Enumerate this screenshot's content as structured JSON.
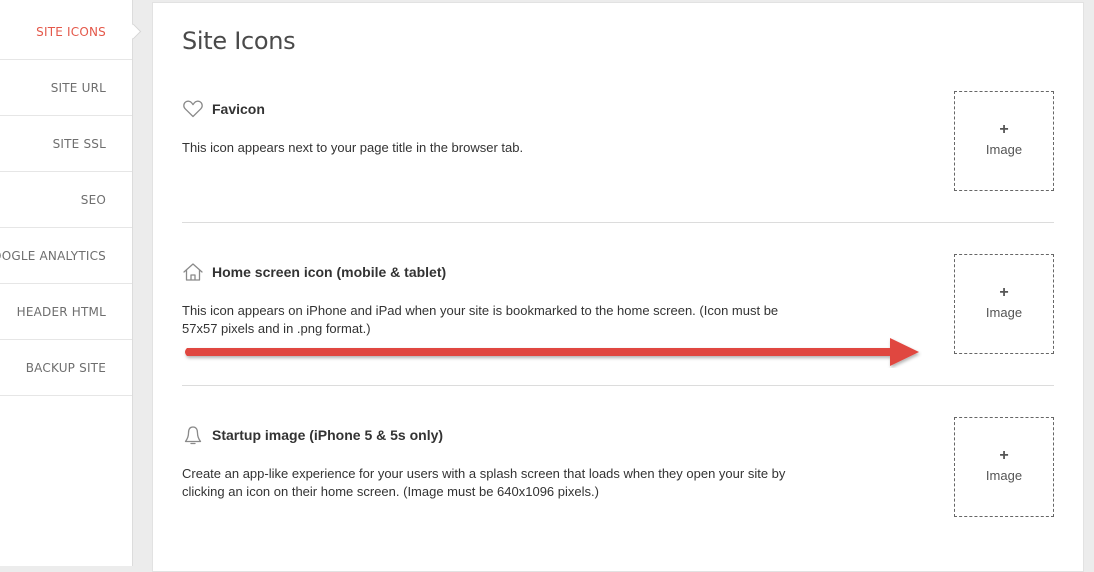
{
  "sidebar": {
    "items": [
      {
        "label": "SITE ICONS",
        "active": true
      },
      {
        "label": "SITE URL",
        "active": false
      },
      {
        "label": "SITE SSL",
        "active": false
      },
      {
        "label": "SEO",
        "active": false
      },
      {
        "label": "GOOGLE ANALYTICS",
        "active": false
      },
      {
        "label": "HEADER HTML",
        "active": false
      },
      {
        "label": "BACKUP SITE",
        "active": false
      }
    ],
    "active_color": "#e4584a"
  },
  "main": {
    "title": "Site Icons",
    "sections": [
      {
        "icon": "heart-icon",
        "title": "Favicon",
        "description": "This icon appears next to your page title in the browser tab.",
        "upload": {
          "plus": "+",
          "label": "Image"
        }
      },
      {
        "icon": "home-icon",
        "title": "Home screen icon (mobile & tablet)",
        "description": "This icon appears on iPhone and iPad when your site is bookmarked to the home screen. (Icon must be 57x57 pixels and in .png format.)",
        "upload": {
          "plus": "+",
          "label": "Image"
        }
      },
      {
        "icon": "bell-icon",
        "title": "Startup image (iPhone 5 & 5s only)",
        "description": "Create an app-like experience for your users with a splash screen that loads when they open your site by clicking an icon on their home screen. (Image must be 640x1096 pixels.)",
        "upload": {
          "plus": "+",
          "label": "Image"
        }
      }
    ]
  },
  "annotation": {
    "type": "arrow",
    "color": "#e0473f"
  }
}
